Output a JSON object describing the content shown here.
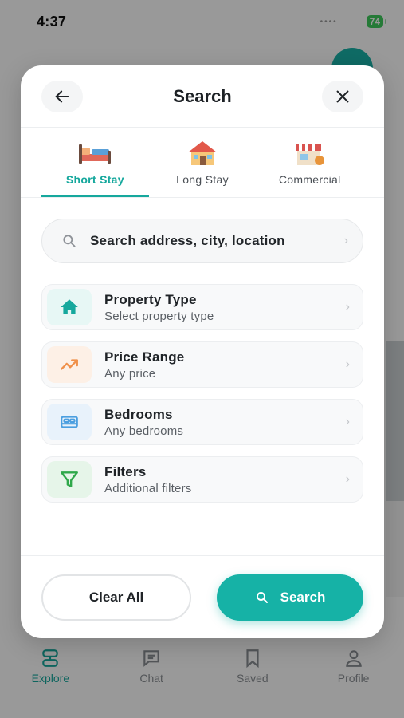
{
  "status_bar": {
    "time": "4:37",
    "battery": "74"
  },
  "modal": {
    "title": "Search",
    "back_icon": "arrow-left-icon",
    "close_icon": "close-icon"
  },
  "stay_tabs": [
    {
      "label": "Short Stay",
      "icon": "bed-icon",
      "active": true
    },
    {
      "label": "Long Stay",
      "icon": "house-icon",
      "active": false
    },
    {
      "label": "Commercial",
      "icon": "shop-icon",
      "active": false
    }
  ],
  "search": {
    "placeholder": "Search address, city, location"
  },
  "filters": [
    {
      "title": "Property Type",
      "subtitle": "Select property type",
      "icon": "home-icon",
      "color": "#16a89d",
      "bg": "#e7f7f5"
    },
    {
      "title": "Price Range",
      "subtitle": "Any price",
      "icon": "trend-up-icon",
      "color": "#f0904a",
      "bg": "#fdf0e6"
    },
    {
      "title": "Bedrooms",
      "subtitle": "Any bedrooms",
      "icon": "bed-icon",
      "color": "#4b9fe0",
      "bg": "#e8f2fb"
    },
    {
      "title": "Filters",
      "subtitle": "Additional filters",
      "icon": "filter-icon",
      "color": "#2fa84a",
      "bg": "#e6f5e9"
    }
  ],
  "footer": {
    "clear_label": "Clear All",
    "search_label": "Search"
  },
  "tab_bar": [
    {
      "label": "Explore",
      "icon": "explore-icon",
      "active": true
    },
    {
      "label": "Chat",
      "icon": "chat-icon",
      "active": false
    },
    {
      "label": "Saved",
      "icon": "bookmark-icon",
      "active": false
    },
    {
      "label": "Profile",
      "icon": "profile-icon",
      "active": false
    }
  ],
  "colors": {
    "accent": "#16b2a6",
    "overlay": "rgba(0,0,0,0.40)"
  }
}
